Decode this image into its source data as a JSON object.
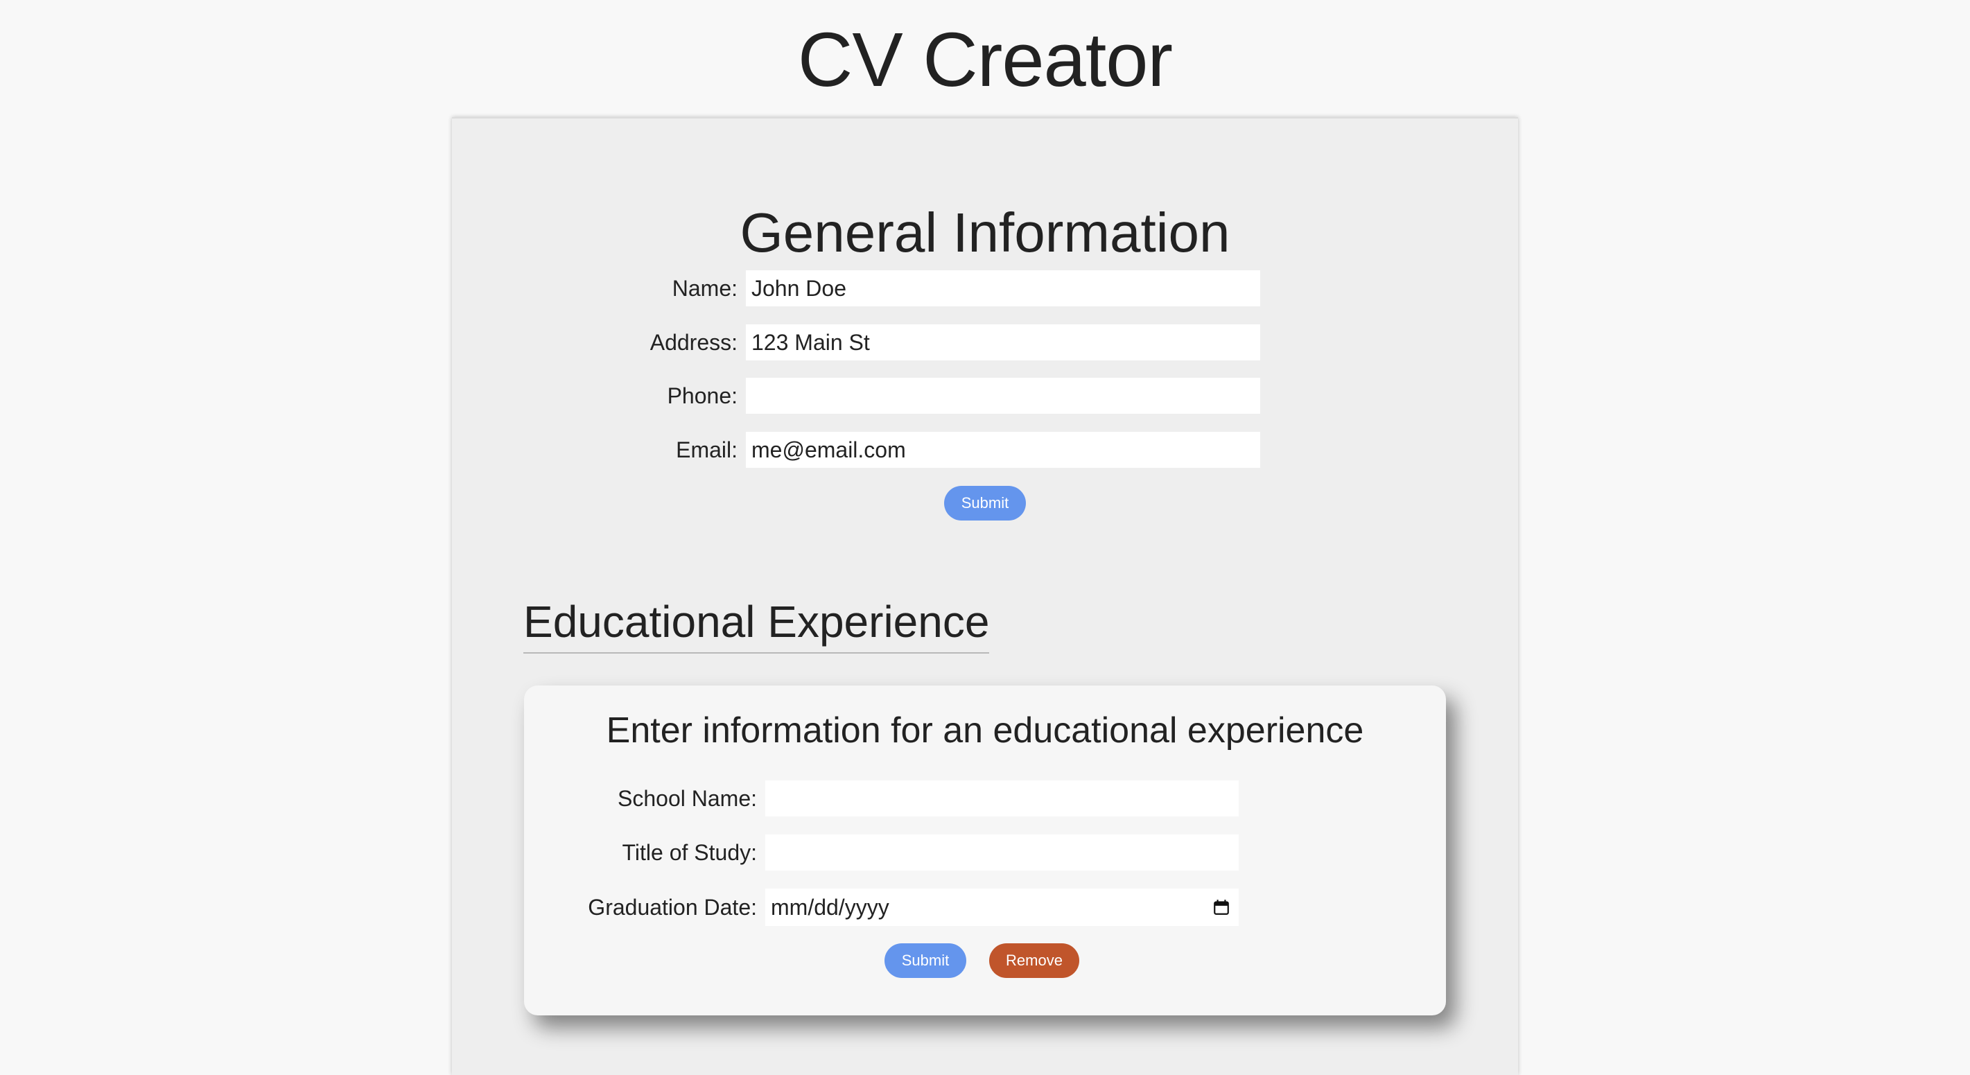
{
  "app": {
    "title": "CV Creator"
  },
  "general": {
    "heading": "General Information",
    "fields": [
      {
        "label": "Name:",
        "value": "John Doe"
      },
      {
        "label": "Address:",
        "value": "123 Main St"
      },
      {
        "label": "Phone:",
        "value": ""
      },
      {
        "label": "Email:",
        "value": "me@email.com"
      }
    ],
    "submit_label": "Submit"
  },
  "education": {
    "heading": "Educational Experience",
    "card": {
      "title": "Enter information for an educational experience",
      "fields": [
        {
          "label": "School Name:",
          "value": ""
        },
        {
          "label": "Title of Study:",
          "value": ""
        },
        {
          "label": "Graduation Date:",
          "value": "mm/dd/yyyy"
        }
      ],
      "submit_label": "Submit",
      "remove_label": "Remove"
    }
  },
  "icons": {
    "date_picker": "calendar-icon"
  },
  "colors": {
    "submit_button": "#6495ed",
    "remove_button": "#c0552b",
    "page_background": "#f8f8f8",
    "panel_background": "#eeeeee"
  }
}
